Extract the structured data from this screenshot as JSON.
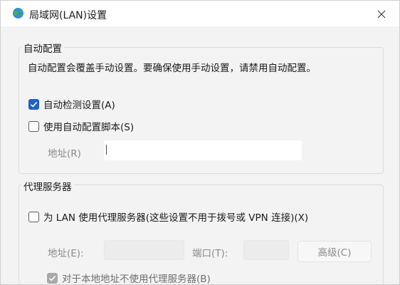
{
  "window": {
    "title": "局域网(LAN)设置",
    "icon": "globe-network-icon",
    "close_icon": "close-icon"
  },
  "auto_config": {
    "legend": "自动配置",
    "description": "自动配置会覆盖手动设置。要确保使用手动设置，请禁用自动配置。",
    "auto_detect": {
      "label": "自动检测设置(A)",
      "checked": true
    },
    "use_script": {
      "label": "使用自动配置脚本(S)",
      "checked": false
    },
    "address_label": "地址(R)",
    "address_value": ""
  },
  "proxy": {
    "legend": "代理服务器",
    "use_proxy": {
      "label": "为 LAN 使用代理服务器(这些设置不用于拨号或 VPN 连接)(X)",
      "checked": false
    },
    "address_label": "地址(E):",
    "address_value": "",
    "port_label": "端口(T):",
    "port_value": "",
    "advanced_button": "高级(C)",
    "bypass_local": {
      "label": "对于本地地址不使用代理服务器(B)",
      "checked": true,
      "enabled": false
    }
  },
  "colors": {
    "accent": "#1d62c4",
    "window_bg": "#f3f3f3",
    "disabled_text": "#8a8a8a"
  }
}
